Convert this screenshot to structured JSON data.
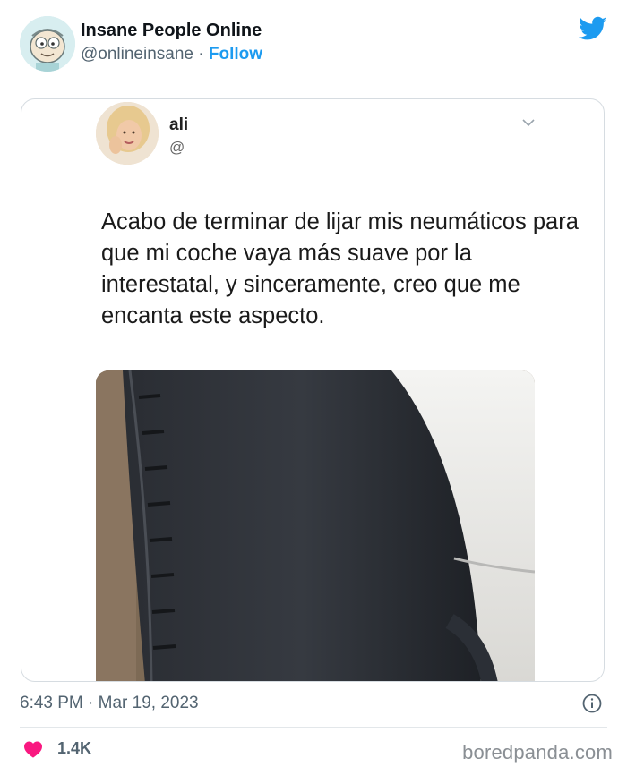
{
  "account": {
    "display_name": "Insane People Online",
    "handle": "@onlineinsane",
    "separator": " · ",
    "follow_label": "Follow",
    "avatar_icon": "cartoon-face-avatar"
  },
  "brand": {
    "icon": "twitter-bird-icon",
    "color": "#1d9bf0"
  },
  "embedded_tweet": {
    "name": "ali",
    "handle": "@",
    "text": "Acabo de terminar de lijar mis neumáticos para que mi coche vaya más suave por la interestatal, y sinceramente, creo que me encanta este aspecto.",
    "image": "car-tire-photo"
  },
  "meta": {
    "timestamp": "6:43 PM · Mar 19, 2023",
    "likes": "1.4K"
  },
  "watermark": "boredpanda.com",
  "colors": {
    "accent": "#1d9bf0",
    "heart": "#f91880",
    "muted": "#536471"
  }
}
